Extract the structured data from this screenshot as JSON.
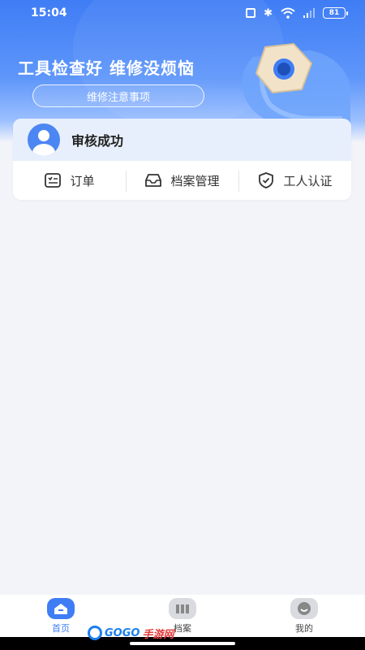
{
  "status_bar": {
    "time": "15:04",
    "battery": "81"
  },
  "hero": {
    "slogan": "工具检查好 维修没烦恼",
    "notice_button": "维修注意事项"
  },
  "card": {
    "user_status": "审核成功",
    "menu": [
      {
        "label": "订单",
        "icon": "order-list-icon"
      },
      {
        "label": "档案管理",
        "icon": "archive-box-icon"
      },
      {
        "label": "工人认证",
        "icon": "shield-check-icon"
      }
    ]
  },
  "bottom_nav": {
    "items": [
      {
        "label": "首页",
        "icon": "home-icon",
        "active": true
      },
      {
        "label": "档案",
        "icon": "files-icon",
        "active": false
      },
      {
        "label": "我的",
        "icon": "profile-face-icon",
        "active": false
      }
    ]
  },
  "watermark": {
    "brand": "GOGO",
    "suffix": "手游网"
  },
  "colors": {
    "primary": "#3f7df5",
    "background": "#f2f4f9",
    "card_header": "#e7eefc"
  }
}
